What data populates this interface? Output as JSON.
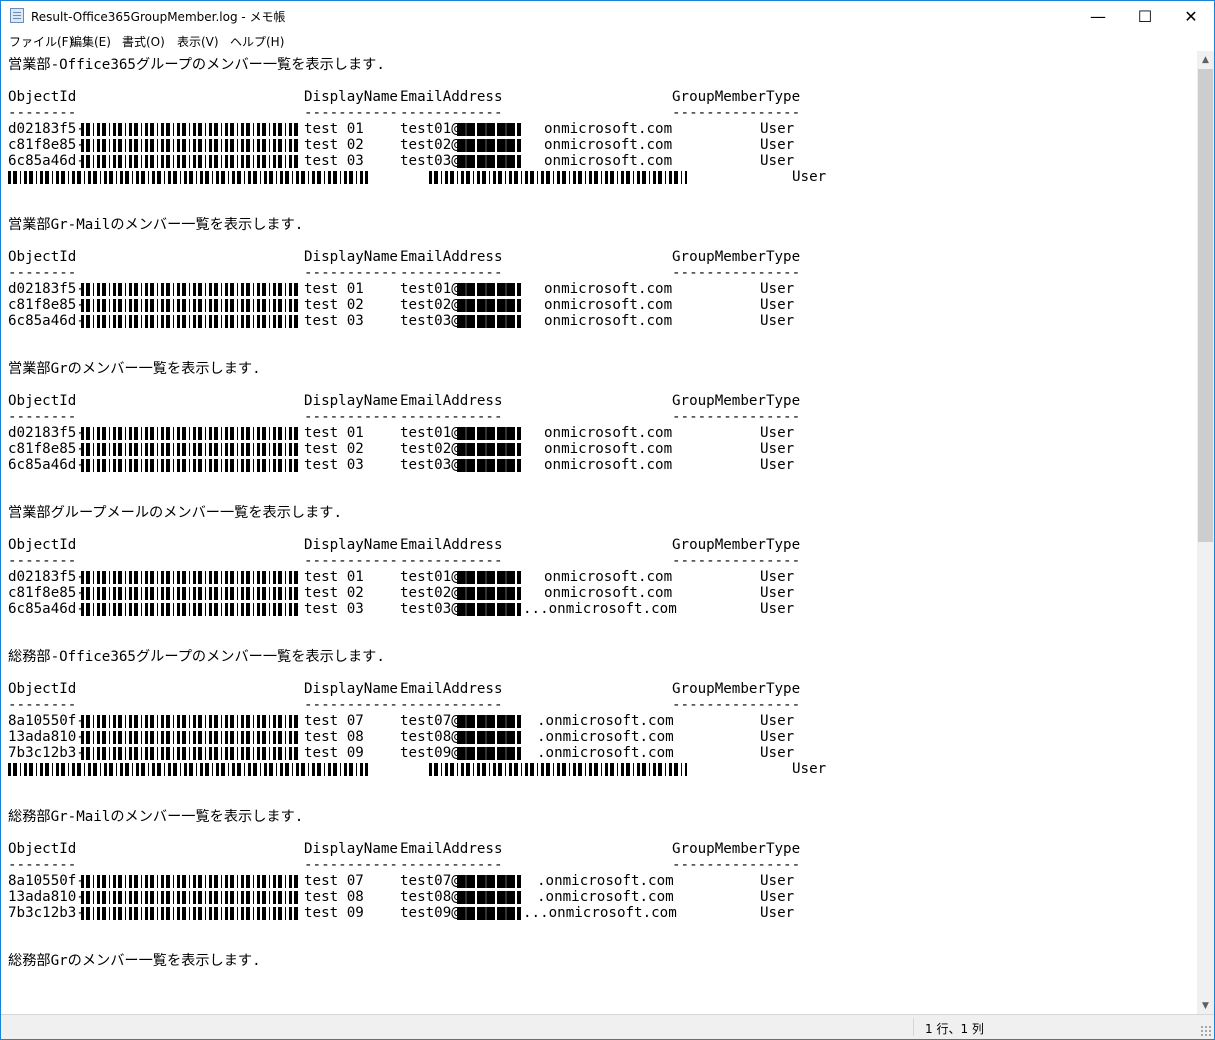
{
  "window": {
    "title": "Result-Office365GroupMember.log - メモ帳"
  },
  "controls": {
    "minimize": "—",
    "maximize": "☐",
    "close": "✕"
  },
  "menu": [
    "ファイル(F)",
    "編集(E)",
    "書式(O)",
    "表示(V)",
    "ヘルプ(H)"
  ],
  "header": {
    "object_id": "ObjectId",
    "display_name": "DisplayName",
    "email": "EmailAddress",
    "type": "GroupMemberType",
    "dash_object_id": "--------",
    "dash_display_name": "-----------",
    "dash_email": "------------",
    "dash_type": "---------------"
  },
  "sections": [
    {
      "title": "営業部-Office365グループのメンバー一覧を表示します.",
      "rows": [
        {
          "id": "d02183f5-",
          "name": "test 01",
          "email_user": "test01@",
          "email_domain": "onmicrosoft.com",
          "type": "User"
        },
        {
          "id": "c81f8e85-",
          "name": "test 02",
          "email_user": "test02@",
          "email_domain": "onmicrosoft.com",
          "type": "User"
        },
        {
          "id": "6c85a46d-",
          "name": "test 03",
          "email_user": "test03@",
          "email_domain": "onmicrosoft.com",
          "type": "User"
        }
      ],
      "extra_type": "User"
    },
    {
      "title": "営業部Gr-Mailのメンバー一覧を表示します.",
      "rows": [
        {
          "id": "d02183f5-",
          "name": "test 01",
          "email_user": "test01@",
          "email_domain": "onmicrosoft.com",
          "type": "User"
        },
        {
          "id": "c81f8e85-",
          "name": "test 02",
          "email_user": "test02@",
          "email_domain": "onmicrosoft.com",
          "type": "User"
        },
        {
          "id": "6c85a46d-",
          "name": "test 03",
          "email_user": "test03@",
          "email_domain": "onmicrosoft.com",
          "type": "User"
        }
      ]
    },
    {
      "title": "営業部Grのメンバー一覧を表示します.",
      "rows": [
        {
          "id": "d02183f5-",
          "name": "test 01",
          "email_user": "test01@",
          "email_domain": "onmicrosoft.com",
          "type": "User"
        },
        {
          "id": "c81f8e85-",
          "name": "test 02",
          "email_user": "test02@",
          "email_domain": "onmicrosoft.com",
          "type": "User"
        },
        {
          "id": "6c85a46d-",
          "name": "test 03",
          "email_user": "test03@",
          "email_domain": "onmicrosoft.com",
          "type": "User"
        }
      ]
    },
    {
      "title": "営業部グループメールのメンバー一覧を表示します.",
      "rows": [
        {
          "id": "d02183f5-",
          "name": "test 01",
          "email_user": "test01@",
          "email_domain": "onmicrosoft.com",
          "type": "User"
        },
        {
          "id": "c81f8e85-",
          "name": "test 02",
          "email_user": "test02@",
          "email_domain": "onmicrosoft.com",
          "type": "User"
        },
        {
          "id": "6c85a46d-",
          "name": "test 03",
          "email_user": "test03@",
          "email_domain": "...onmicrosoft.com",
          "type": "User"
        }
      ]
    },
    {
      "title": "総務部-Office365グループのメンバー一覧を表示します.",
      "rows": [
        {
          "id": "8a10550f-",
          "name": "test 07",
          "email_user": "test07@",
          "email_domain": ".onmicrosoft.com",
          "type": "User"
        },
        {
          "id": "13ada810-",
          "name": "test 08",
          "email_user": "test08@",
          "email_domain": ".onmicrosoft.com",
          "type": "User"
        },
        {
          "id": "7b3c12b3-",
          "name": "test 09",
          "email_user": "test09@",
          "email_domain": ".onmicrosoft.com",
          "type": "User"
        }
      ],
      "extra_type": "User"
    },
    {
      "title": "総務部Gr-Mailのメンバー一覧を表示します.",
      "rows": [
        {
          "id": "8a10550f-",
          "name": "test 07",
          "email_user": "test07@",
          "email_domain": ".onmicrosoft.com",
          "type": "User"
        },
        {
          "id": "13ada810-",
          "name": "test 08",
          "email_user": "test08@",
          "email_domain": ".onmicrosoft.com",
          "type": "User"
        },
        {
          "id": "7b3c12b3-",
          "name": "test 09",
          "email_user": "test09@",
          "email_domain": "...onmicrosoft.com",
          "type": "User"
        }
      ]
    },
    {
      "title": "総務部Grのメンバー一覧を表示します.",
      "rows": []
    }
  ],
  "status": {
    "position": "1 行、1 列"
  }
}
